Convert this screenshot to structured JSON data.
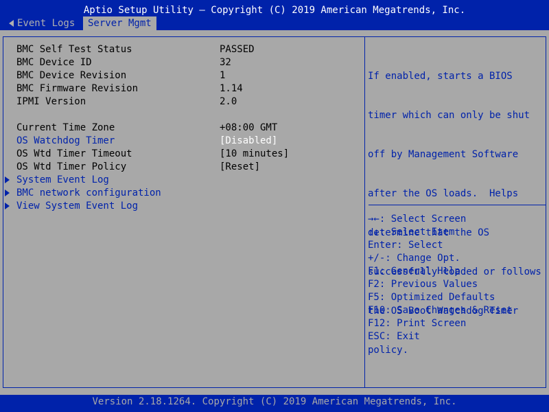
{
  "title": "Aptio Setup Utility – Copyright (C) 2019 American Megatrends, Inc.",
  "tabs": {
    "previous": "Event Logs",
    "active": "Server Mgmt"
  },
  "bmc_info": [
    {
      "label": "BMC Self Test Status",
      "value": "PASSED"
    },
    {
      "label": "BMC Device ID",
      "value": "32"
    },
    {
      "label": "BMC Device Revision",
      "value": "1"
    },
    {
      "label": "BMC Firmware Revision",
      "value": "1.14"
    },
    {
      "label": "IPMI Version",
      "value": "2.0"
    }
  ],
  "time_zone": {
    "label": "Current Time Zone",
    "value": "+08:00 GMT"
  },
  "settings": [
    {
      "label": "OS Watchdog Timer",
      "value": "[Disabled]",
      "selected": true
    },
    {
      "label": "OS Wtd Timer Timeout",
      "value": "[10 minutes]",
      "selected": false
    },
    {
      "label": "OS Wtd Timer Policy",
      "value": "[Reset]",
      "selected": false
    }
  ],
  "submenus": [
    "System Event Log",
    "BMC network configuration",
    "View System Event Log"
  ],
  "help": [
    "If enabled, starts a BIOS",
    "timer which can only be shut",
    "off by Management Software",
    "after the OS loads.  Helps",
    "determine that the OS",
    "successfully loaded or follows",
    "the OS Boot Watchdog Timer",
    "policy."
  ],
  "keys": [
    "→←: Select Screen",
    "↑↓: Select Item",
    "Enter: Select",
    "+/-: Change Opt.",
    "F1: General Help",
    "F2: Previous Values",
    "F5: Optimized Defaults",
    "F10: Save Changes & Reset",
    "F12: Print Screen",
    "ESC: Exit"
  ],
  "footer": "Version 2.18.1264. Copyright (C) 2019 American Megatrends, Inc.",
  "colors": {
    "bios_blue": "#0022aa",
    "panel_gray": "#a8a8a8",
    "highlight_white": "#ffffff"
  }
}
